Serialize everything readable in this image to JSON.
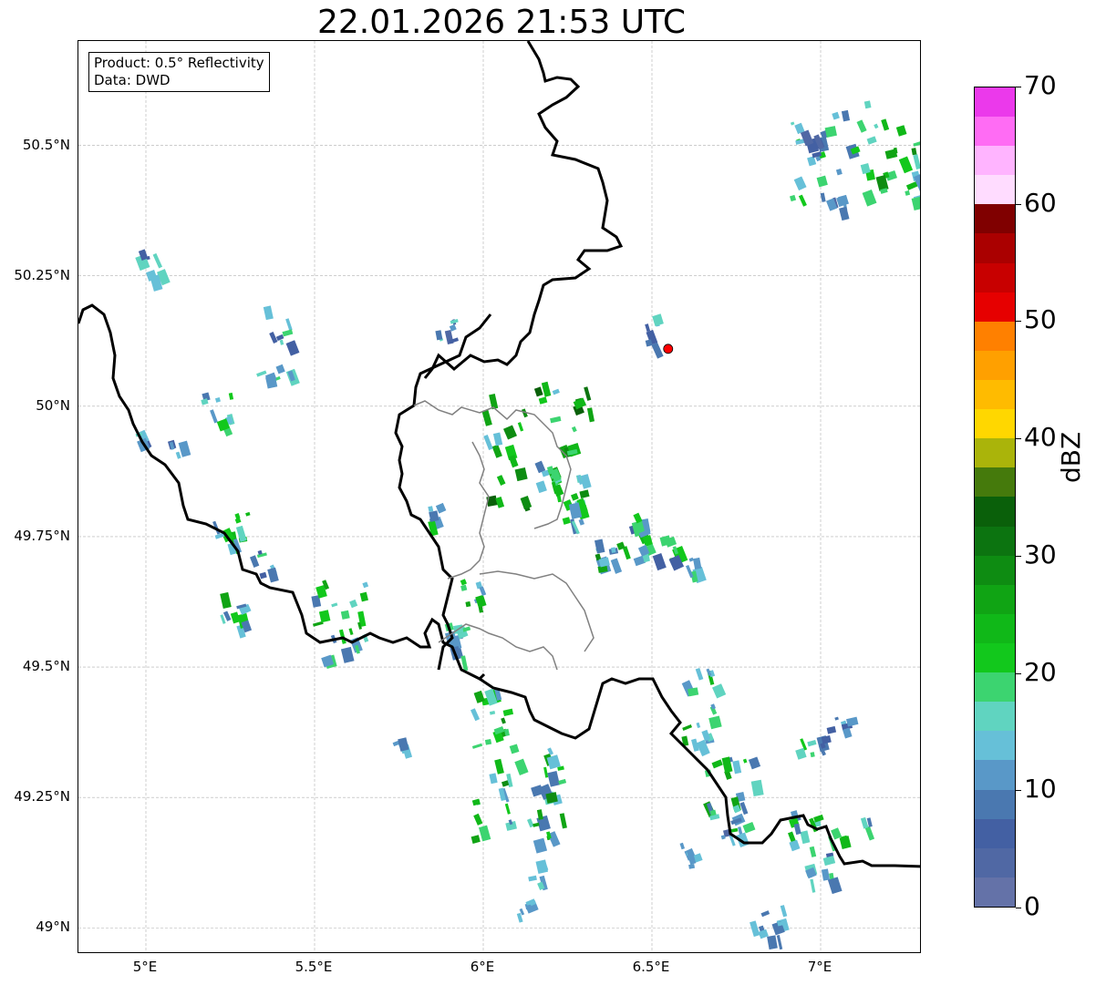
{
  "title": "22.01.2026 21:53 UTC",
  "info": {
    "product": "Product: 0.5° Reflectivity",
    "data": "Data: DWD"
  },
  "map": {
    "lon_range": [
      4.8,
      7.3
    ],
    "lat_range": [
      48.95,
      50.7
    ],
    "lat_ticks": [
      {
        "value": 50.5,
        "label": "50.5°N"
      },
      {
        "value": 50.25,
        "label": "50.25°N"
      },
      {
        "value": 50.0,
        "label": "50°N"
      },
      {
        "value": 49.75,
        "label": "49.75°N"
      },
      {
        "value": 49.5,
        "label": "49.5°N"
      },
      {
        "value": 49.25,
        "label": "49.25°N"
      },
      {
        "value": 49.0,
        "label": "49°N"
      }
    ],
    "lon_ticks": [
      {
        "value": 5.0,
        "label": "5°E"
      },
      {
        "value": 5.5,
        "label": "5.5°E"
      },
      {
        "value": 6.0,
        "label": "6°E"
      },
      {
        "value": 6.5,
        "label": "6.5°E"
      },
      {
        "value": 7.0,
        "label": "7°E"
      }
    ],
    "radar_site": {
      "lon": 6.548,
      "lat": 50.11,
      "color": "#ff0000"
    },
    "border_color": "#000000",
    "internal_border_color": "#808080"
  },
  "colorbar": {
    "unit": "dBZ",
    "min": 0,
    "max": 70,
    "tick_labels": [
      "0",
      "10",
      "20",
      "30",
      "40",
      "50",
      "60",
      "70"
    ],
    "colors": [
      "#6472a8",
      "#5068a4",
      "#4360a3",
      "#4a78b0",
      "#5998c8",
      "#66c0d8",
      "#60d4c0",
      "#3cd470",
      "#12c81c",
      "#10b818",
      "#10a414",
      "#0e8c12",
      "#0c7410",
      "#0a600a",
      "#457a0c",
      "#aab40a",
      "#ffd700",
      "#ffbb00",
      "#ffa000",
      "#ff8000",
      "#e60000",
      "#c80000",
      "#aa0000",
      "#800000",
      "#ffdcff",
      "#ffb4ff",
      "#ff6cf4",
      "#eb39eb"
    ]
  }
}
